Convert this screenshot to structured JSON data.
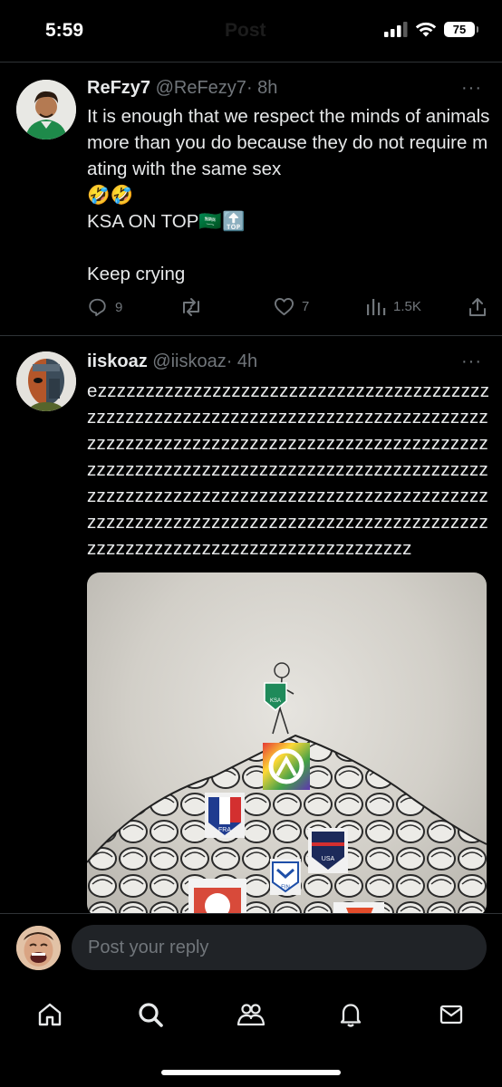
{
  "status_bar": {
    "time": "5:59",
    "battery": "75",
    "ghost_title": "Post"
  },
  "tweets": [
    {
      "name": "ReFzy7",
      "handle": "@ReFezy7",
      "time": "· 8h",
      "more": "···",
      "text": "It is enough that we respect the minds of animals more than you do because they do not require mating with the same sex\n🤣🤣\nKSA ON TOP🇸🇦🔝\n\nKeep crying",
      "replies": "9",
      "reposts": "",
      "likes": "7",
      "views": "1.5K"
    },
    {
      "name": "iiskoaz",
      "handle": "@iiskoaz",
      "time": "· 4h",
      "more": "···",
      "text": "ezzzzzzzzzzzzzzzzzzzzzzzzzzzzzzzzzzzzzzzzzzzzzzzzzzzzzzzzzzzzzzzzzzzzzzzzzzzzzzzzzzzzzzzzzzzzzzzzzzzzzzzzzzzzzzzzzzzzzzzzzzzzzzzzzzzzzzzzzzzzzzzzzzzzzzzzzzzzzzzzzzzzzzzzzzzzzzzzzzzzzzzzzzzzzzzzzzzzzzzzzzzzzzzzzzzzzzzzzzzzzzzzzzzzzzzzzzzzzzzzzzzzzzzzzzzzzzzzzzzzzzzzzzzzzzzzzzzzzzzzzzzzz",
      "media_labels": [
        "KSA",
        "FRA",
        "USA",
        "FIN"
      ]
    }
  ],
  "reply": {
    "placeholder": "Post your reply"
  },
  "tabs": [
    "home",
    "search",
    "communities",
    "notifications",
    "messages"
  ],
  "colors": {
    "background": "#000000",
    "text": "#e7e9ea",
    "muted": "#71767b",
    "divider": "#2f3336"
  }
}
